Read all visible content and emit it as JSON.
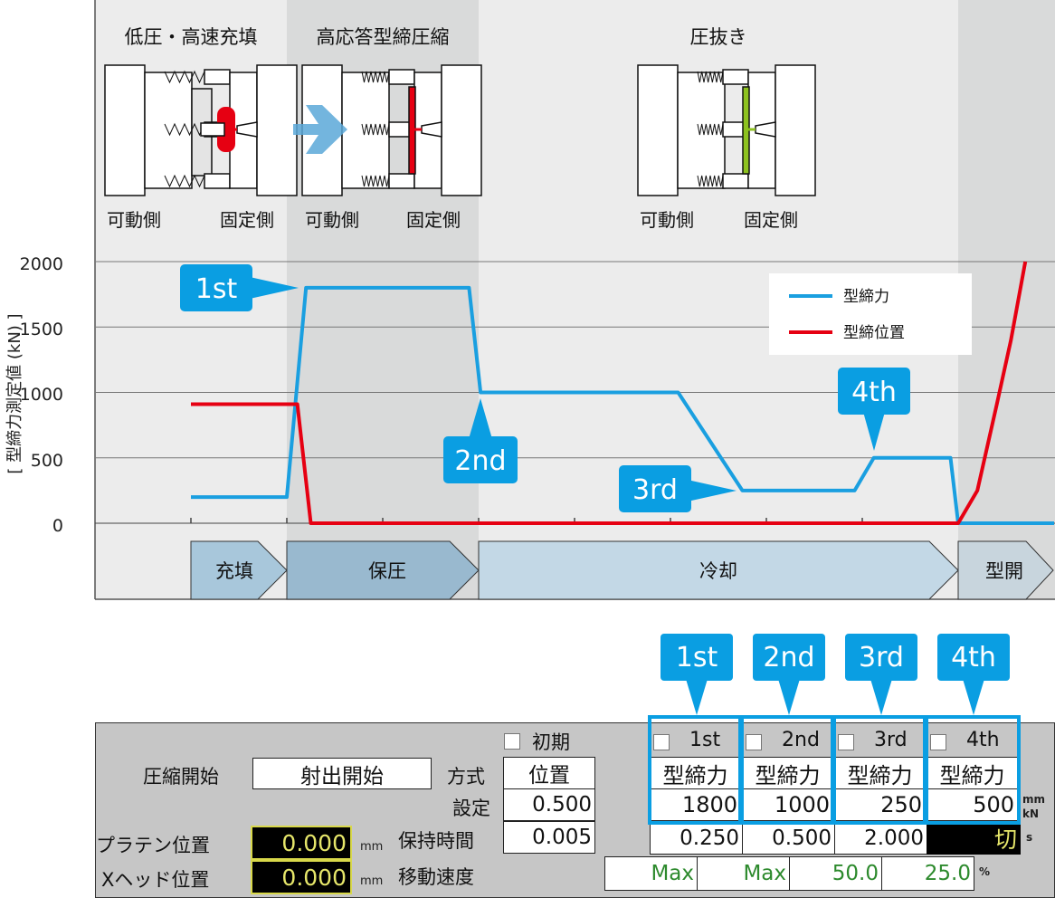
{
  "stages": [
    {
      "title": "低圧・高速充填",
      "movable": "可動側",
      "fixed": "固定側"
    },
    {
      "title": "高応答型締圧縮",
      "movable": "可動側",
      "fixed": "固定側"
    },
    {
      "title": "圧抜き",
      "movable": "可動側",
      "fixed": "固定側"
    }
  ],
  "phases": [
    "充填",
    "保圧",
    "冷却",
    "型開"
  ],
  "callouts": [
    "1st",
    "2nd",
    "3rd",
    "4th"
  ],
  "colors": {
    "clamp_force": "#1a9fe0",
    "clamp_position": "#e60012",
    "callout": "#0a9ee2",
    "resin": "#e60012",
    "cooled_resin": "#8dc21f",
    "arrow": "#5aa8d8"
  },
  "icons": [
    "mold-diagram-icon",
    "press-arrow-icon",
    "checkbox-icon"
  ],
  "chart_data": {
    "type": "line",
    "ylabel": "[ 型締力測定値 (kN) ]",
    "ylim": [
      0,
      2000
    ],
    "yticks": [
      "2000",
      "1500",
      "1000",
      "500",
      "0"
    ],
    "grid": true,
    "legend_position": "top-right",
    "series": [
      {
        "name": "型締力",
        "color": "#1a9fe0",
        "points": [
          [
            1,
            200
          ],
          [
            2,
            200
          ],
          [
            2.2,
            1800
          ],
          [
            3.9,
            1800
          ],
          [
            4.02,
            1000
          ],
          [
            6.08,
            1000
          ],
          [
            6.75,
            250
          ],
          [
            7.92,
            250
          ],
          [
            8.12,
            500
          ],
          [
            8.92,
            500
          ],
          [
            9,
            0
          ],
          [
            10,
            0
          ]
        ]
      },
      {
        "name": "型締位置",
        "color": "#e60012",
        "points": [
          [
            1,
            910
          ],
          [
            2.11,
            910
          ],
          [
            2.25,
            0
          ],
          [
            9,
            0
          ],
          [
            9.2,
            250
          ],
          [
            9.4,
            900
          ],
          [
            9.55,
            1400
          ],
          [
            9.7,
            2000
          ]
        ]
      }
    ]
  },
  "panel": {
    "initial_label": "初期",
    "compress_start_label": "圧縮開始",
    "compress_start_value": "射出開始",
    "method_label": "方式",
    "method_value": "位置",
    "setting_label": "設定",
    "setting_value": "0.500",
    "hold_time_label": "保持時間",
    "hold_time_value": "0.005",
    "platen_label": "プラテン位置",
    "platen_value": "0.000",
    "xhead_label": "Xヘッド位置",
    "xhead_value": "0.000",
    "mm": "mm",
    "speed_label": "移動速度",
    "steps": [
      {
        "name": "1st",
        "mode": "型締力",
        "value": "1800",
        "time": "0.250",
        "speed": "Max"
      },
      {
        "name": "2nd",
        "mode": "型締力",
        "value": "1000",
        "time": "0.500",
        "speed": "Max"
      },
      {
        "name": "3rd",
        "mode": "型締力",
        "value": "250",
        "time": "2.000",
        "speed": "50.0"
      },
      {
        "name": "4th",
        "mode": "型締力",
        "value": "500",
        "time": "切",
        "speed": "25.0"
      }
    ],
    "unit_value_mm": "mm",
    "unit_value_kn": "kN",
    "unit_time": "s",
    "unit_speed": "%"
  }
}
